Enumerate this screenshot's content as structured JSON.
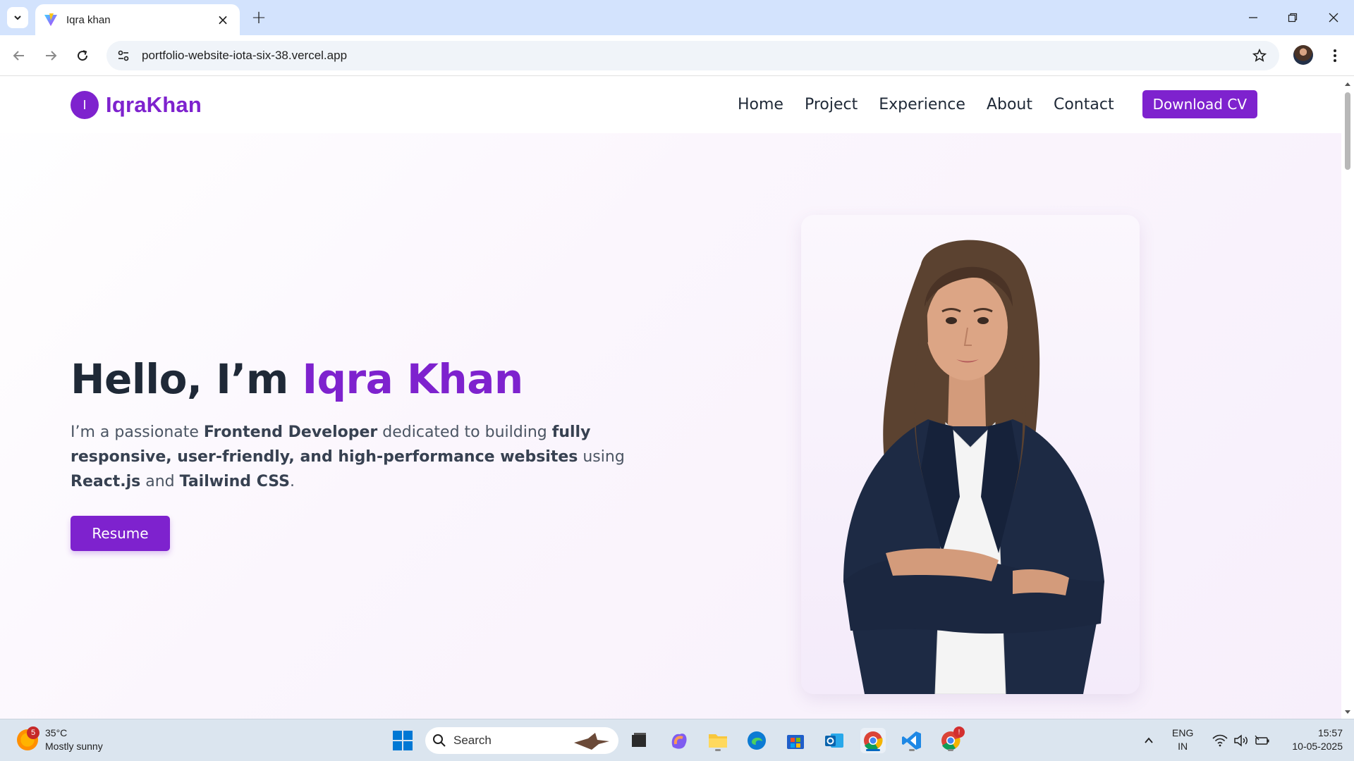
{
  "browser": {
    "tab_title": "Iqra khan",
    "url": "portfolio-website-iota-six-38.vercel.app"
  },
  "site": {
    "logo_letter": "I",
    "logo_text": "IqraKhan",
    "nav": [
      "Home",
      "Project",
      "Experience",
      "About",
      "Contact"
    ],
    "download_cv": "Download CV",
    "hero": {
      "greeting": "Hello, I’m ",
      "name": "Iqra Khan",
      "p1": "I’m a passionate ",
      "b1": "Frontend Developer",
      "p2": " dedicated to building ",
      "b2": "fully responsive, user-friendly, and high-performance websites",
      "p3": " using ",
      "b3": "React.js",
      "p4": " and ",
      "b4": "Tailwind CSS",
      "p5": "."
    },
    "resume_button": "Resume",
    "accent_color": "#7e22ce"
  },
  "taskbar": {
    "weather_badge": "5",
    "temperature": "35°C",
    "weather_desc": "Mostly sunny",
    "search_label": "Search",
    "chrome_badge": "!",
    "lang_line1": "ENG",
    "lang_line2": "IN",
    "time": "15:57",
    "date": "10-05-2025"
  }
}
